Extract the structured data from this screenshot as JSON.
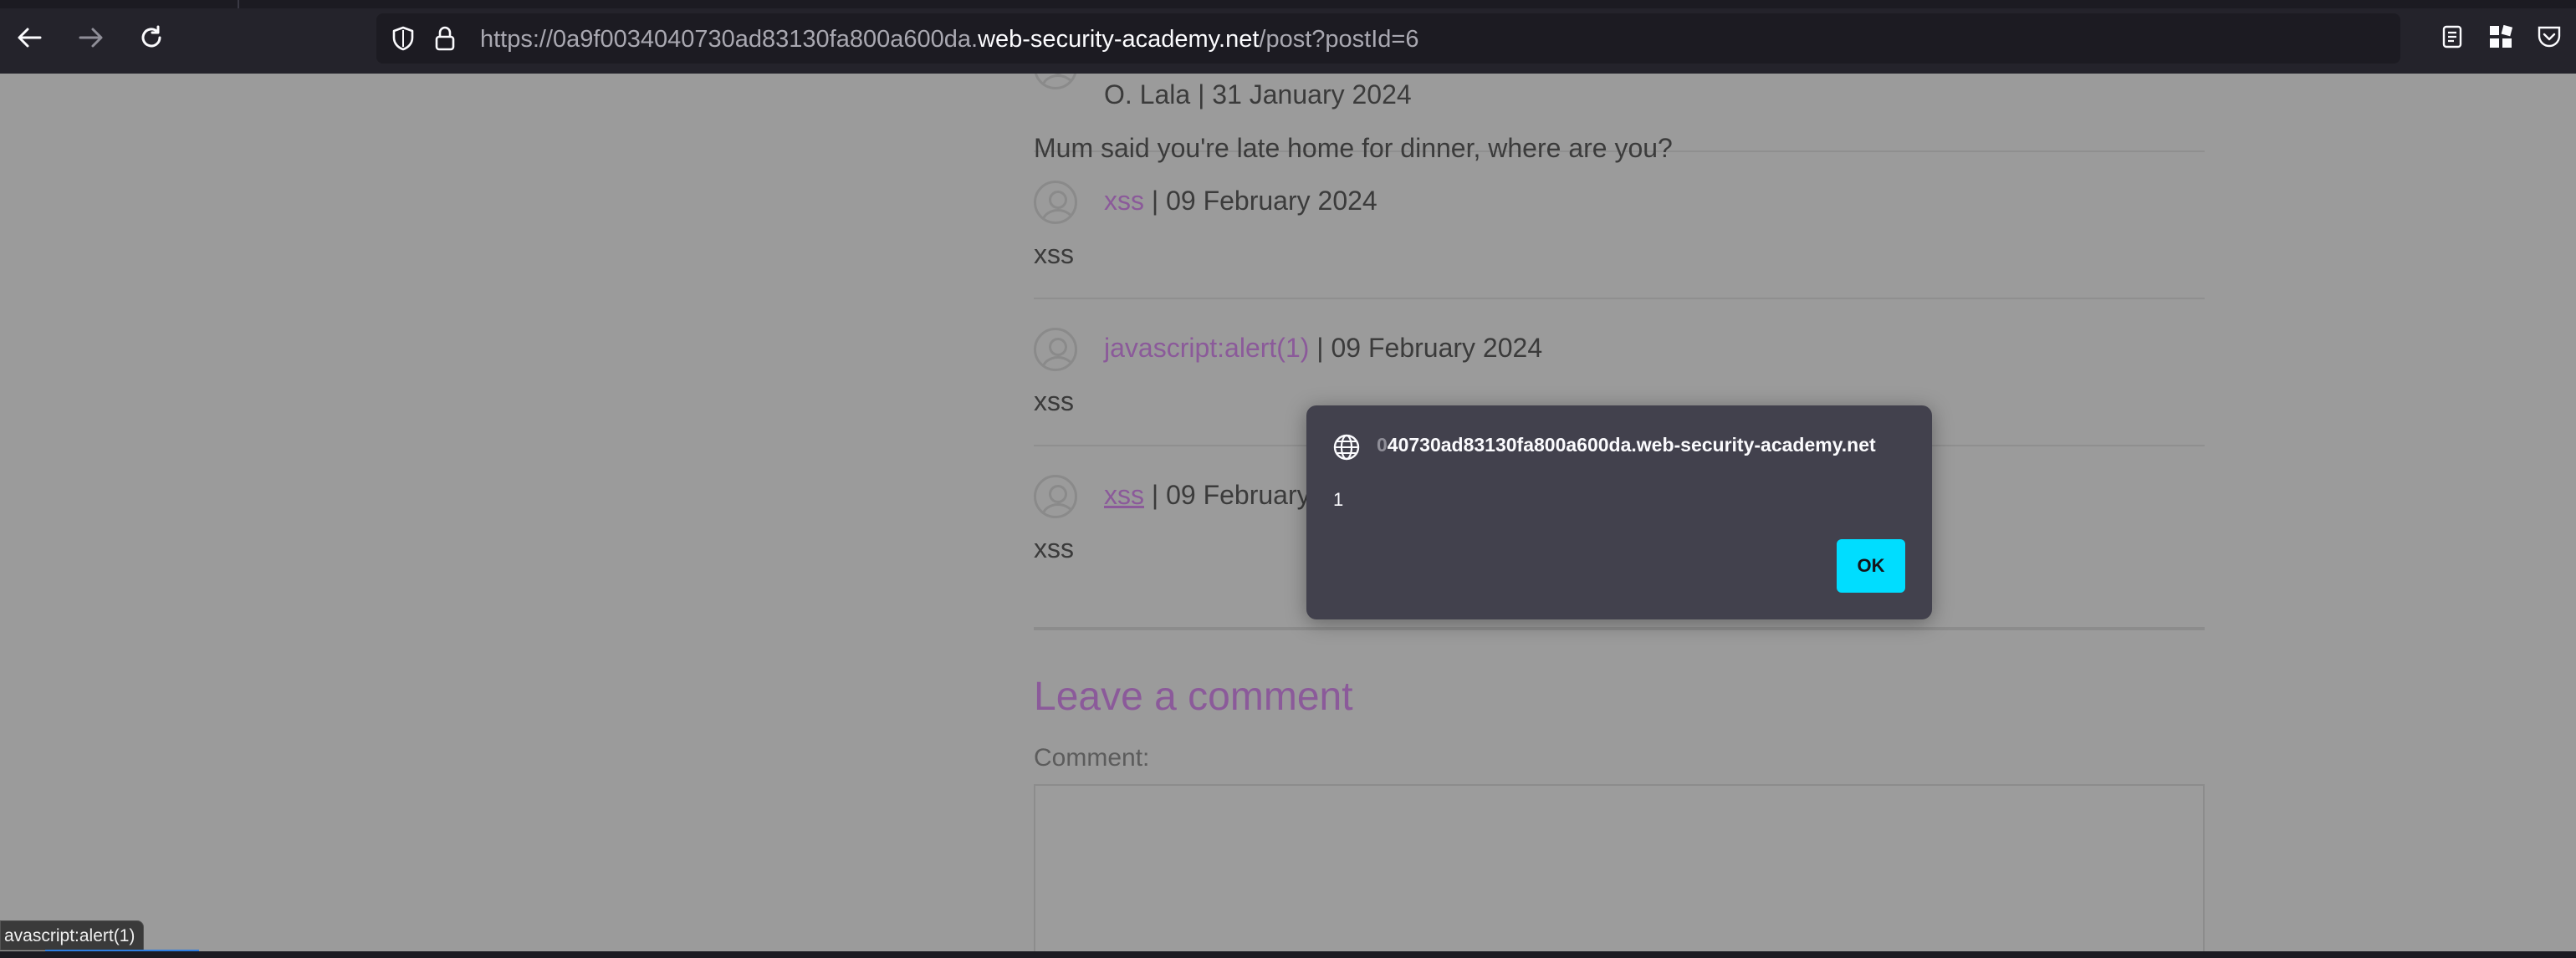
{
  "browser": {
    "url_prefix": "https://0a9f0034040730ad83130fa800a600da.",
    "url_host": "web-security-academy.net",
    "url_path": "/post?postId=6"
  },
  "comments": [
    {
      "author": "O. Lala",
      "author_is_link": false,
      "separator": " | ",
      "date": "31 January 2024",
      "text": "Mum said you're late home for dinner, where are you?"
    },
    {
      "author": "xss",
      "author_is_link": true,
      "separator": " | ",
      "date": "09 February 2024",
      "text": "xss"
    },
    {
      "author": "javascript:alert(1)",
      "author_is_link": true,
      "separator": " | ",
      "date": "09 February 2024",
      "text": "xss"
    },
    {
      "author": "xss",
      "author_is_link": true,
      "separator": " | ",
      "date": "09 February",
      "text": "xss"
    }
  ],
  "leave_comment": {
    "heading": "Leave a comment",
    "comment_label": "Comment:"
  },
  "alert_dialog": {
    "origin_faded": "0",
    "origin": "40730ad83130fa800a600da.web-security-academy.net",
    "message": "1",
    "ok_label": "OK"
  },
  "status_bar": {
    "text": "avascript:alert(1)"
  },
  "icons": {
    "back": "back-arrow-icon",
    "forward": "forward-arrow-icon",
    "reload": "reload-icon",
    "shield": "shield-icon",
    "lock": "lock-icon",
    "reader": "reader-view-icon",
    "extensions": "extensions-icon",
    "pocket": "save-icon",
    "globe": "globe-icon"
  },
  "colors": {
    "link_purple": "#8b5a9a",
    "ok_button": "#00ddff",
    "dialog_bg": "#42414d"
  }
}
